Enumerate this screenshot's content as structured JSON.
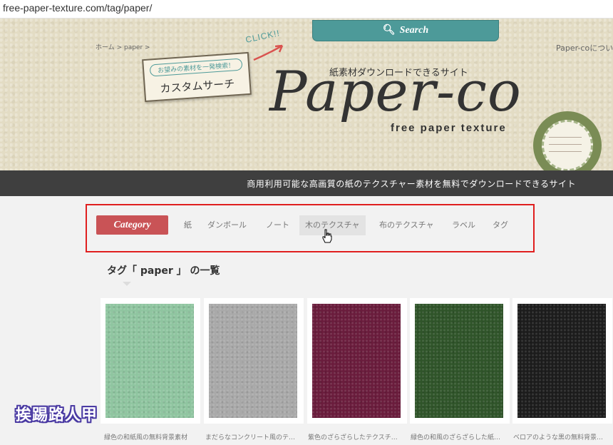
{
  "browser": {
    "url": "free-paper-texture.com/tag/paper/"
  },
  "header": {
    "search_label": "Search",
    "breadcrumb": "ホーム > paper >",
    "right_link": "Paper-coについ",
    "click_text": "CLICK!!",
    "custom_search": {
      "small": "お望みの素材を一発検索！",
      "big": "カスタムサーチ"
    },
    "subtitle": "紙素材ダウンロードできるサイト",
    "logo": "Paper-co",
    "tagline": "free paper texture"
  },
  "band_text": "商用利用可能な高画質の紙のテクスチャー素材を無料でダウンロードできるサイト",
  "category": {
    "label": "Category",
    "items": [
      "紙",
      "ダンボール",
      "ノート",
      "木のテクスチャ",
      "布のテクスチャ",
      "ラベル",
      "タグ"
    ],
    "hovered_index": 3
  },
  "section_title": "タグ「 paper 」 の一覧",
  "cards": [
    {
      "caption": "緑色の和紙風の無料背景素材",
      "color": "#8fc5a0"
    },
    {
      "caption": "まだらなコンクリート風のテ…",
      "color": "#a9a9a9"
    },
    {
      "caption": "紫色のざらざらしたテクスチ…",
      "color": "#6a1c3c"
    },
    {
      "caption": "緑色の和風のざらざらした紙…",
      "color": "#2f5429"
    },
    {
      "caption": "ベロアのような黒の無料背景…",
      "color": "#1c1c1c"
    }
  ],
  "watermark": "挨踢路人甲",
  "colors": {
    "teal": "#4d9a99",
    "category_pill": "#c95356",
    "highlight_border": "#e01f1f",
    "band": "#3f3f3f"
  }
}
